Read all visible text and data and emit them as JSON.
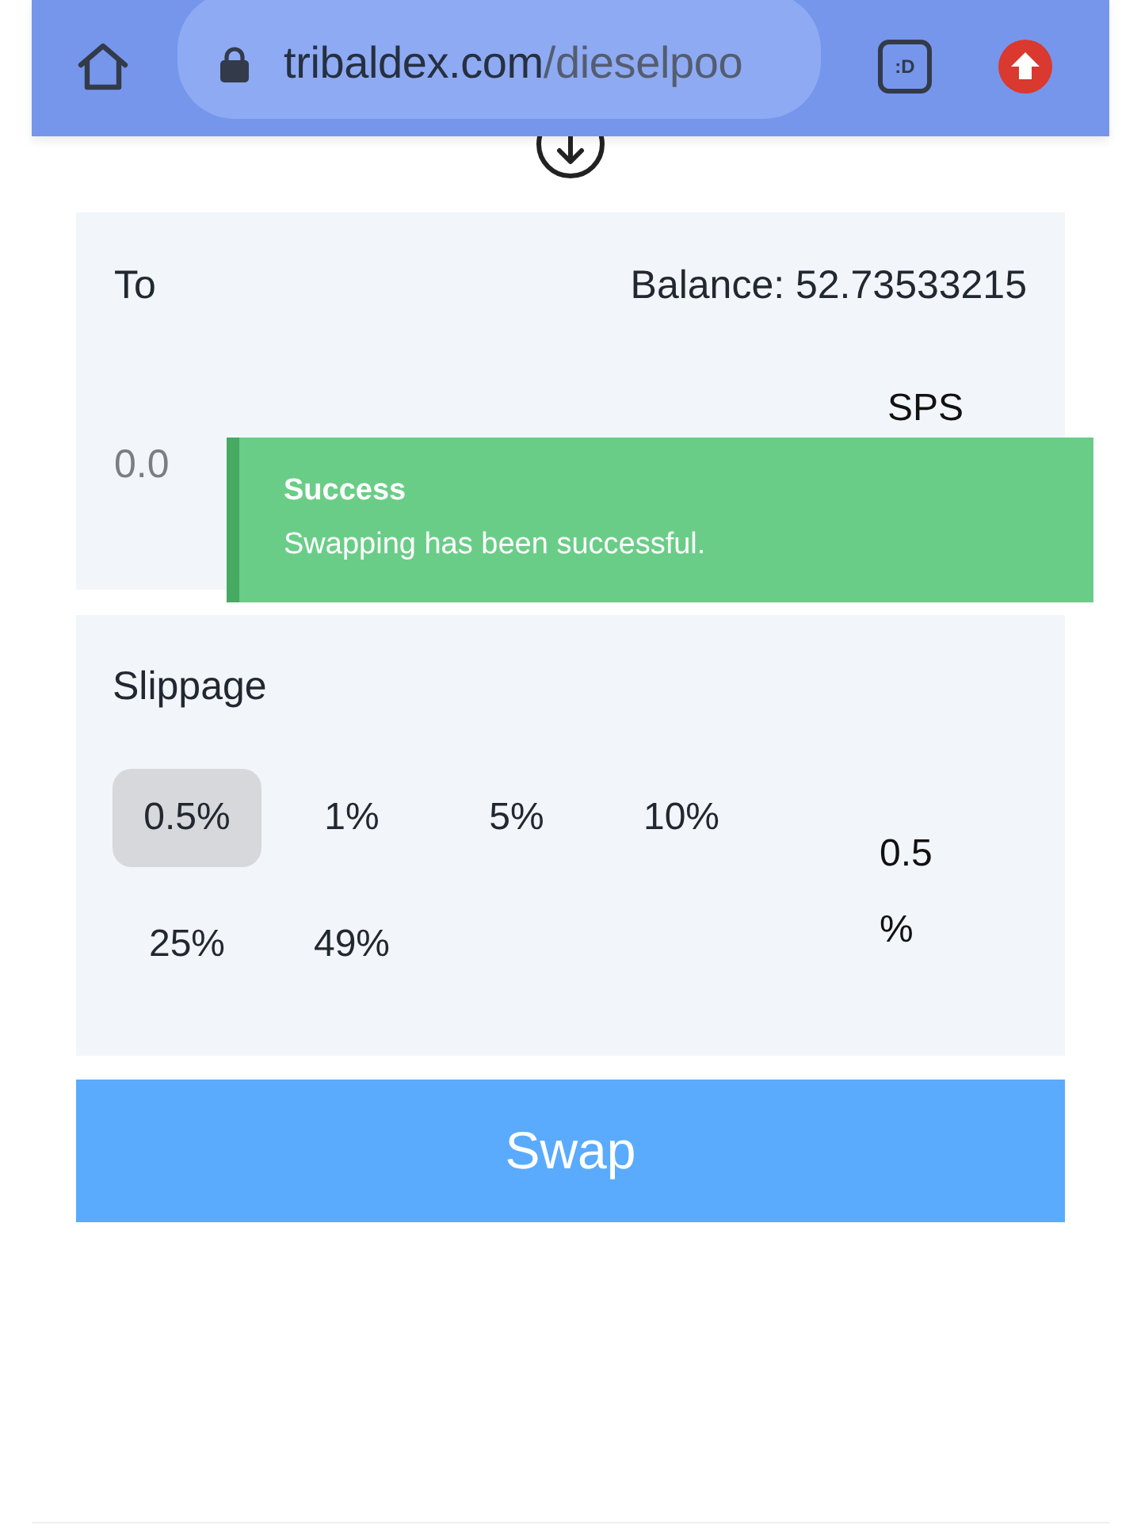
{
  "browser_bar": {
    "url_domain": "tribaldex.com",
    "url_path": "/dieselpoo",
    "tab_switcher_label": ":D"
  },
  "to_panel": {
    "label": "To",
    "balance": "Balance: 52.73533215",
    "amount_placeholder": "0.0",
    "token": "SPS"
  },
  "toast": {
    "kind": "success",
    "title": "Success",
    "message": "Swapping has been successful."
  },
  "slippage": {
    "label": "Slippage",
    "options": [
      {
        "label": "0.5%",
        "selected": true
      },
      {
        "label": "1%",
        "selected": false
      },
      {
        "label": "5%",
        "selected": false
      },
      {
        "label": "10%",
        "selected": false
      },
      {
        "label": "25%",
        "selected": false
      },
      {
        "label": "49%",
        "selected": false
      }
    ],
    "custom_value": "0.5",
    "custom_unit": "%"
  },
  "swap_button": {
    "label": "Swap"
  }
}
